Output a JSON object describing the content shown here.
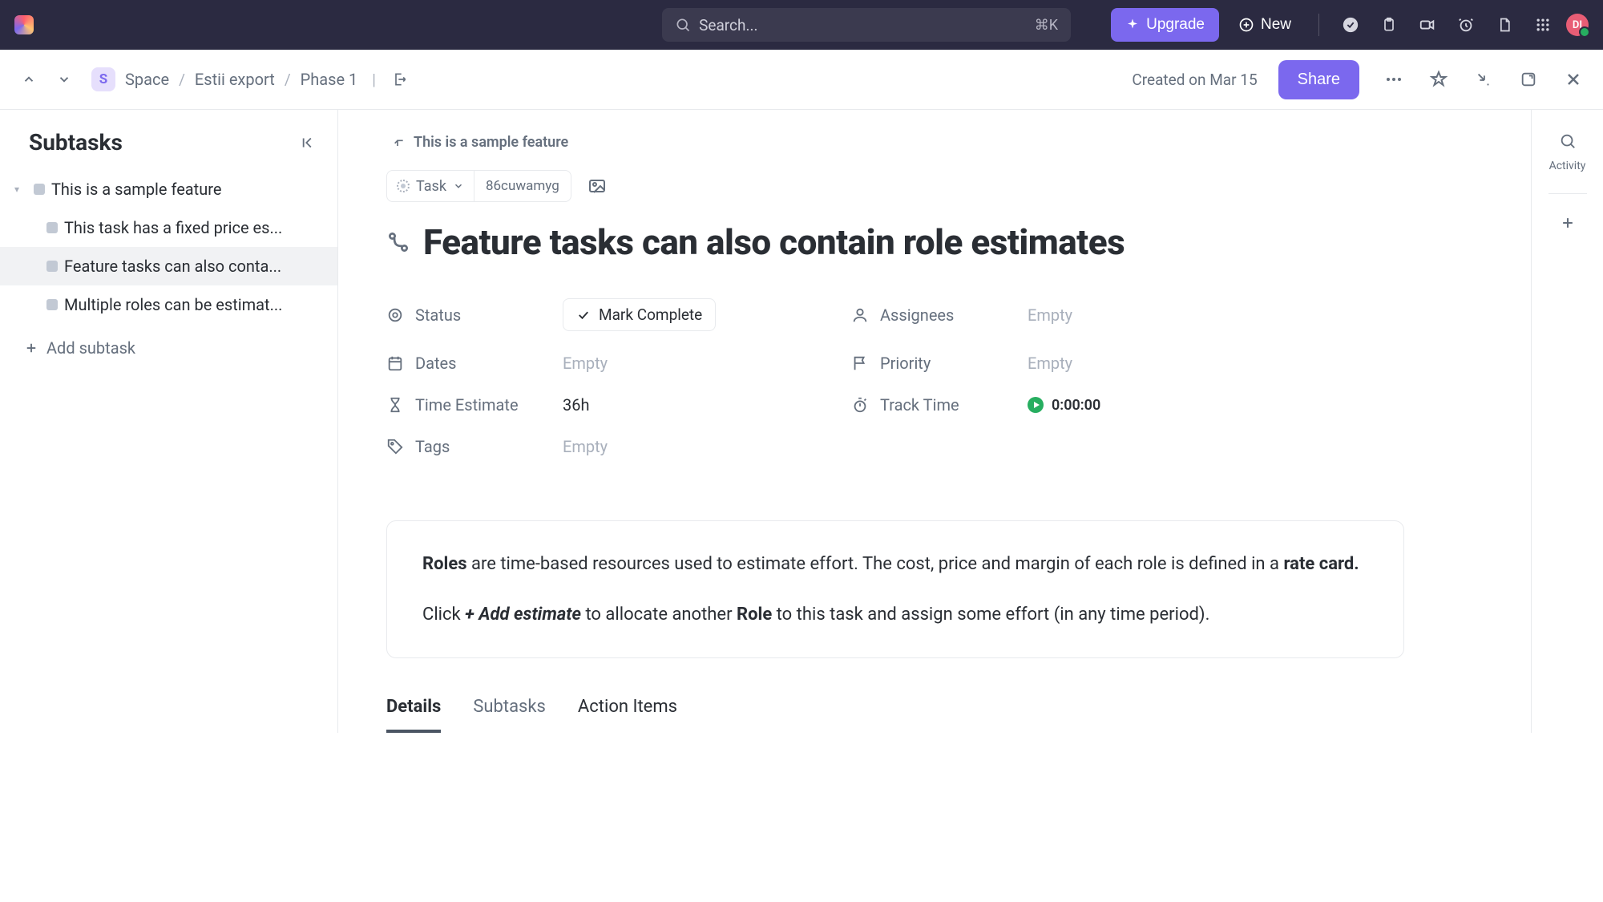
{
  "topbar": {
    "search_placeholder": "Search...",
    "search_kbd": "⌘K",
    "upgrade_label": "Upgrade",
    "new_label": "New",
    "avatar_initials": "DI"
  },
  "breadcrumb": {
    "space_badge": "S",
    "items": [
      "Space",
      "Estii export",
      "Phase 1"
    ],
    "created_on": "Created on Mar 15",
    "share_label": "Share"
  },
  "sidebar": {
    "title": "Subtasks",
    "parent": "This is a sample feature",
    "items": [
      {
        "label": "This task has a fixed price es..."
      },
      {
        "label": "Feature tasks can also conta..."
      },
      {
        "label": "Multiple roles can be estimat..."
      }
    ],
    "add_subtask": "Add subtask"
  },
  "task": {
    "parent_link": "This is a sample feature",
    "type_label": "Task",
    "id": "86cuwamyg",
    "title": "Feature tasks can also contain role estimates",
    "fields": {
      "status_label": "Status",
      "mark_complete": "Mark Complete",
      "assignees_label": "Assignees",
      "assignees_value": "Empty",
      "dates_label": "Dates",
      "dates_value": "Empty",
      "priority_label": "Priority",
      "priority_value": "Empty",
      "time_estimate_label": "Time Estimate",
      "time_estimate_value": "36h",
      "track_time_label": "Track Time",
      "track_time_value": "0:00:00",
      "tags_label": "Tags",
      "tags_value": "Empty"
    },
    "description": {
      "p1_before": "Roles",
      "p1_mid": " are time-based resources used to estimate effort. The cost, price and margin of each role is defined in a ",
      "p1_bold2": "rate card.",
      "p2_before": "Click ",
      "p2_bold1": "+ Add estimate",
      "p2_mid": " to allocate another ",
      "p2_bold2": "Role",
      "p2_after": " to this task and assign some effort (in any time period)."
    },
    "tabs": [
      "Details",
      "Subtasks",
      "Action Items"
    ]
  },
  "activity": {
    "label": "Activity"
  }
}
